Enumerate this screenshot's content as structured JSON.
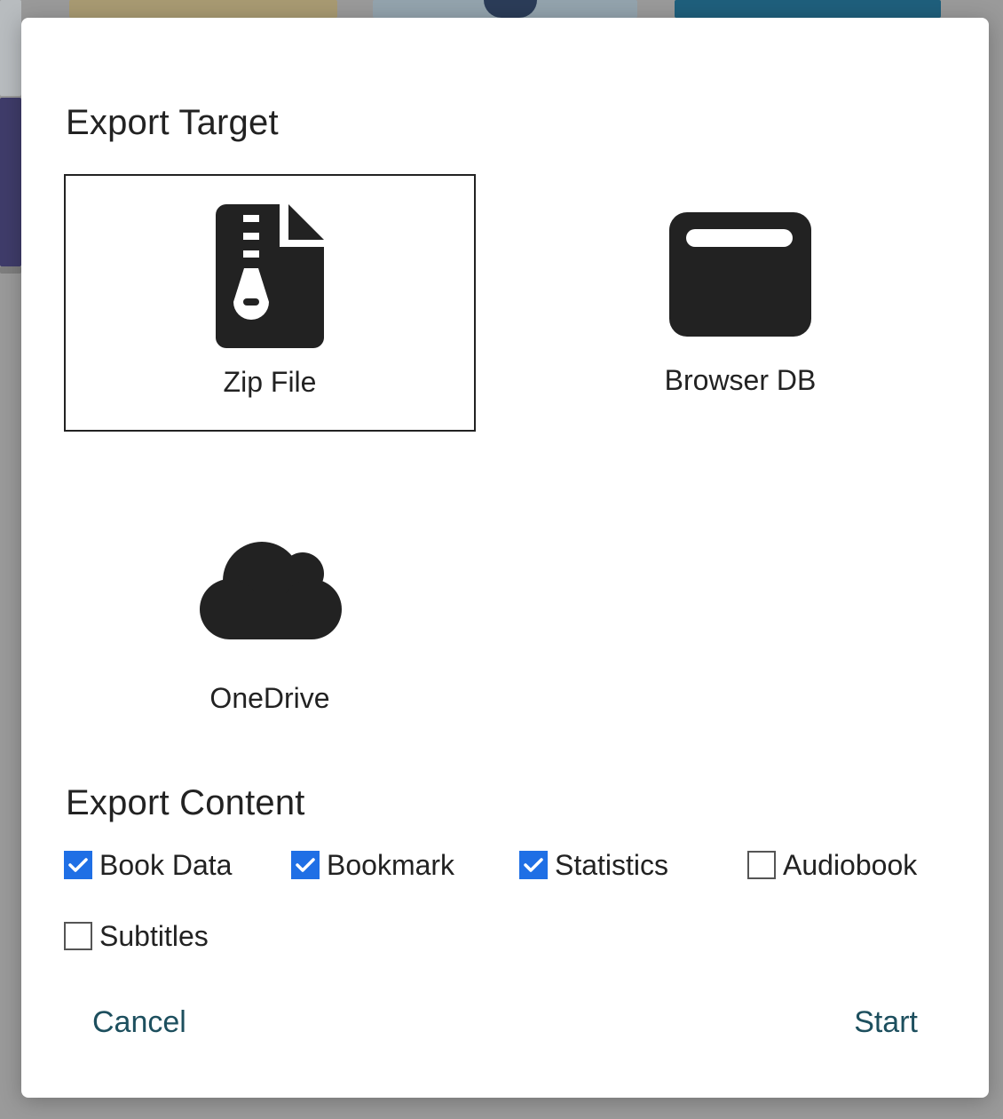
{
  "dialog": {
    "target_title": "Export Target",
    "content_title": "Export Content",
    "targets": [
      {
        "label": "Zip File",
        "icon": "zip-file-icon",
        "selected": true
      },
      {
        "label": "Browser DB",
        "icon": "browser-window-icon",
        "selected": false
      },
      {
        "label": "OneDrive",
        "icon": "cloud-icon",
        "selected": false
      }
    ],
    "contents": [
      {
        "label": "Book Data",
        "checked": true
      },
      {
        "label": "Bookmark",
        "checked": true
      },
      {
        "label": "Statistics",
        "checked": true
      },
      {
        "label": "Audiobook",
        "checked": false
      },
      {
        "label": "Subtitles",
        "checked": false
      }
    ],
    "cancel_label": "Cancel",
    "start_label": "Start"
  },
  "colors": {
    "checkbox_checked": "#1f6fe5",
    "action_text": "#1d4f5e",
    "icon_fill": "#222222",
    "selected_border": "#222222"
  }
}
